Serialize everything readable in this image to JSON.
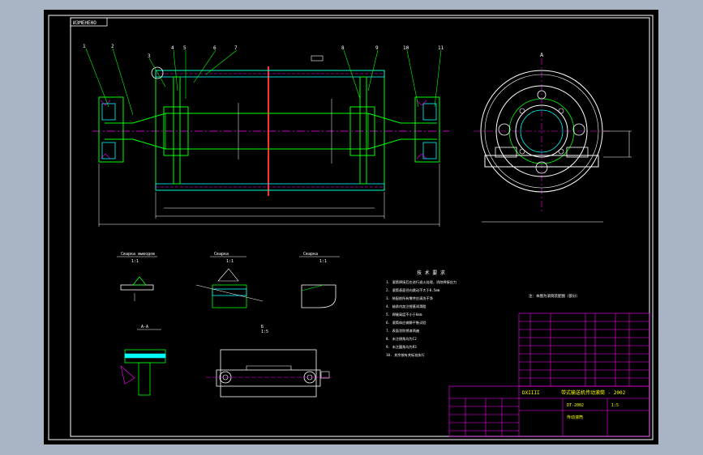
{
  "colors": {
    "background_window": "#a9b5c4",
    "canvas": "#000000",
    "frame": "#ffffff",
    "outline": "#00ff00",
    "centerline": "#ff00ff",
    "dimension": "#ffffff",
    "hidden": "#00ffff",
    "section_axis": "#ff3030",
    "title_text": "#ffff00"
  },
  "drawing": {
    "tag_top_left": "ИЗМЕНЕНО",
    "leader_numbers": [
      "1",
      "2",
      "3",
      "4",
      "5",
      "6",
      "7",
      "8",
      "9",
      "10",
      "11"
    ],
    "dim_total_length": "",
    "view_label_side": "A",
    "detail_titles": [
      "Сварка выводов ",
      "Сварка ",
      "Сварка "
    ],
    "detail_scales": [
      "1:1",
      "1:1",
      "1:1"
    ],
    "detail4_title": "А-А",
    "detail5_title": "Б",
    "detail5_scale": "1:5",
    "notes_title": "技 术 要 求",
    "notes_lines": [
      "1. 滚筒焊接后应进行退火处理，消除焊接应力",
      "2. 滚筒表面径向跳动不大于0.5mm",
      "3. 装配前所有零件应清洗干净",
      "4. 轴承内加注锂基润滑脂",
      "5. 焊缝高度不小于6mm",
      "6. 滚筒体应做静平衡试验",
      "7. 表面涂防锈漆两遍",
      "8. 未注倒角均为C2",
      "9. 未注圆角均为R3",
      "10. 其余按有关标准执行"
    ],
    "note_right": "注：本图为滚筒装配图（部分）",
    "title_block": {
      "company": "DXIIII",
      "title": "带式输送机传动滚筒 - 2002",
      "drawing_no": "DT-2002",
      "scale": "1:5",
      "name": "传动滚筒"
    }
  }
}
